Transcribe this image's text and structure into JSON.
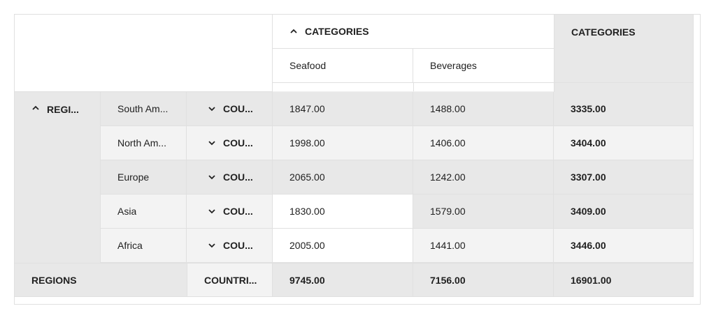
{
  "header": {
    "col_dimension_label": "CATEGORIES",
    "grand_total_col_label": "CATEGORIES",
    "columns": [
      "Seafood",
      "Beverages"
    ]
  },
  "rows": {
    "dimension_label": "REGI...",
    "sub_dimension_label": "COU...",
    "items": [
      {
        "region": "South Am...",
        "country": "COU...",
        "seafood": "1847.00",
        "beverages": "1488.00",
        "total": "3335.00"
      },
      {
        "region": "North Am...",
        "country": "COU...",
        "seafood": "1998.00",
        "beverages": "1406.00",
        "total": "3404.00"
      },
      {
        "region": "Europe",
        "country": "COU...",
        "seafood": "2065.00",
        "beverages": "1242.00",
        "total": "3307.00"
      },
      {
        "region": "Asia",
        "country": "COU...",
        "seafood": "1830.00",
        "beverages": "1579.00",
        "total": "3409.00"
      },
      {
        "region": "Africa",
        "country": "COU...",
        "seafood": "2005.00",
        "beverages": "1441.00",
        "total": "3446.00"
      }
    ]
  },
  "footer": {
    "regions_label": "REGIONS",
    "countries_label": "COUNTRI...",
    "seafood_total": "9745.00",
    "beverages_total": "7156.00",
    "grand_total": "16901.00"
  },
  "icons": {
    "expanded": "chevron-up-icon",
    "collapsed": "chevron-down-icon"
  }
}
